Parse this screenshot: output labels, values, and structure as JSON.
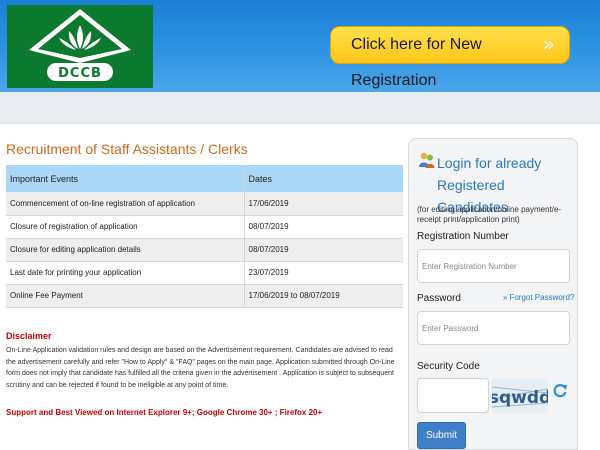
{
  "header": {
    "logo_text": "DCCB",
    "registration_button": "Click here for New Registration",
    "registration_arrow": "»"
  },
  "main": {
    "title": "Recruitment of Staff Assistants / Clerks",
    "table": {
      "headers": [
        "Important Events",
        "Dates"
      ],
      "rows": [
        [
          "Commencement of on-line registration of application",
          "17/06/2019"
        ],
        [
          "Closure of registration of application",
          "08/07/2019"
        ],
        [
          "Closure for editing application details",
          "08/07/2019"
        ],
        [
          "Last date for printing your application",
          "23/07/2019"
        ],
        [
          "Online Fee Payment",
          "17/06/2019 to 08/07/2019"
        ]
      ]
    },
    "disclaimer": {
      "heading": "Disclaimer",
      "text": "On-Line Application validation rules and design are based on the Advertisement requirement. Candidates are advised to read the advertisement carefully and refer \"How to Apply\" & \"FAQ\" pages on the main page. Application submitted through On-Line form does not imply that candidate has fulfilled all the criteria given in the advertisement . Application is subject to subsequent scrutiny and can be rejected if found to be ineligible at any point of time."
    },
    "support": "Support and Best Viewed on Internet Explorer 9+; Google Chrome 30+ ; Firefox 20+"
  },
  "login": {
    "heading": "Login for already Registered Candidates",
    "subtitle": "(for editing application/online payment/e-receipt print/application print)",
    "registration_label": "Registration Number",
    "registration_placeholder": "Enter Registration Number",
    "password_label": "Password",
    "forgot_chevron": "»",
    "forgot_label": "Forgot Password?",
    "password_placeholder": "Enter Password",
    "security_label": "Security Code",
    "captcha_text": "sqwdd",
    "submit_label": "Submit"
  },
  "colors": {
    "header_blue": "#2e93e3",
    "logo_green": "#0b7a2e",
    "cta_yellow": "#ffc61a",
    "title_orange": "#d2691e",
    "table_header": "#a9d7f5",
    "link_blue": "#2b79c2",
    "alert_red": "#cc0000",
    "submit_blue": "#3f7fc8"
  },
  "icons": [
    "lotus-logo-icon",
    "double-chevron-right-icon",
    "users-login-icon",
    "refresh-icon"
  ]
}
